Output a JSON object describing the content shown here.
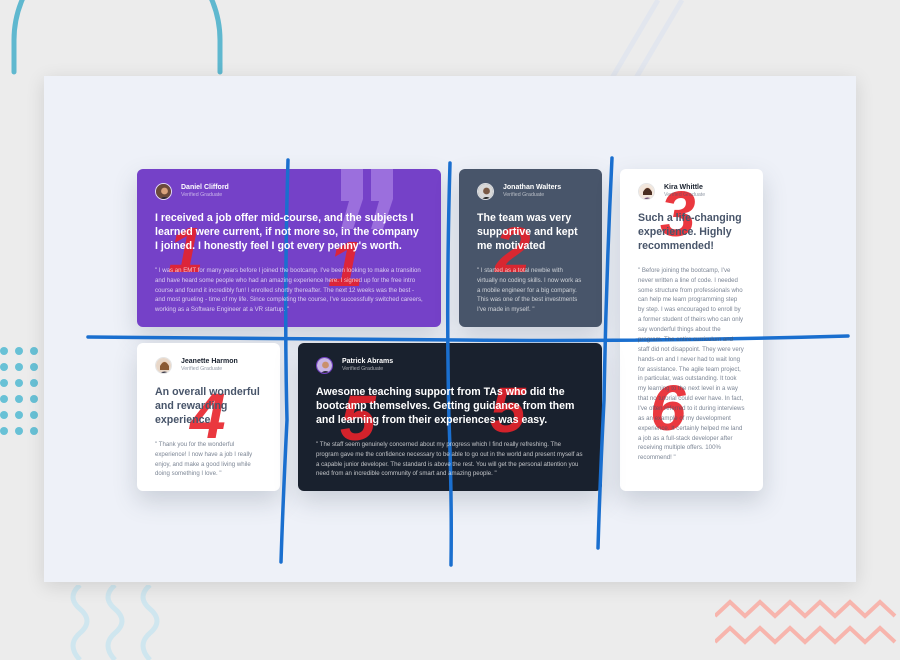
{
  "colors": {
    "purple": "#7541c8",
    "slate": "#48556a",
    "dark": "#19212e",
    "white": "#ffffff",
    "stage_bg": "#eef1f8",
    "annotation_line": "#1a6fcf",
    "annotation_number": "#e8232b"
  },
  "testimonials": [
    {
      "name": "Daniel Clifford",
      "role": "Verified Graduate",
      "headline": "I received a job offer mid-course, and the subjects I learned were current, if not more so, in the company I joined. I honestly feel I got every penny's worth.",
      "body": "\" I was an EMT for many years before I joined the bootcamp. I've been looking to make a transition and have heard some people who had an amazing experience here. I signed up for the free intro course and found it incredibly fun! I enrolled shortly thereafter. The next 12 weeks was the best - and most grueling - time of my life. Since completing the course, I've successfully switched careers, working as a Software Engineer at a VR startup. \""
    },
    {
      "name": "Jonathan Walters",
      "role": "Verified Graduate",
      "headline": "The team was very supportive and kept me motivated",
      "body": "\" I started as a total newbie with virtually no coding skills. I now work as a mobile engineer for a big company. This was one of the best investments I've made in myself. \""
    },
    {
      "name": "Kira Whittle",
      "role": "Verified Graduate",
      "headline": "Such a life-changing experience. Highly recommended!",
      "body": "\" Before joining the bootcamp, I've never written a line of code. I needed some structure from professionals who can help me learn programming step by step. I was encouraged to enroll by a former student of theirs who can only say wonderful things about the program. The entire curriculum and staff did not disappoint. They were very hands-on and I never had to wait long for assistance. The agile team project, in particular, was outstanding. It took my learning to the next level in a way that no tutorial could ever have. In fact, I've often referred to it during interviews as an example of my development experience. It certainly helped me land a job as a full-stack developer after receiving multiple offers. 100% recommend! \""
    },
    {
      "name": "Jeanette Harmon",
      "role": "Verified Graduate",
      "headline": "An overall wonderful and rewarding experience",
      "body": "\" Thank you for the wonderful experience! I now have a job I really enjoy, and make a good living while doing something I love. \""
    },
    {
      "name": "Patrick Abrams",
      "role": "Verified Graduate",
      "headline": "Awesome teaching support from TAs who did the bootcamp themselves. Getting guidance from them and learning from their experiences was easy.",
      "body": "\" The staff seem genuinely concerned about my progress which I find really refreshing. The program gave me the confidence necessary to be able to go out in the world and present myself as a capable junior developer. The standard is above the rest. You will get the personal attention you need from an incredible community of smart and amazing people. \""
    }
  ],
  "annotations": {
    "numbers": [
      "1",
      "1",
      "2",
      "3",
      "4",
      "5",
      "5",
      "6"
    ]
  }
}
